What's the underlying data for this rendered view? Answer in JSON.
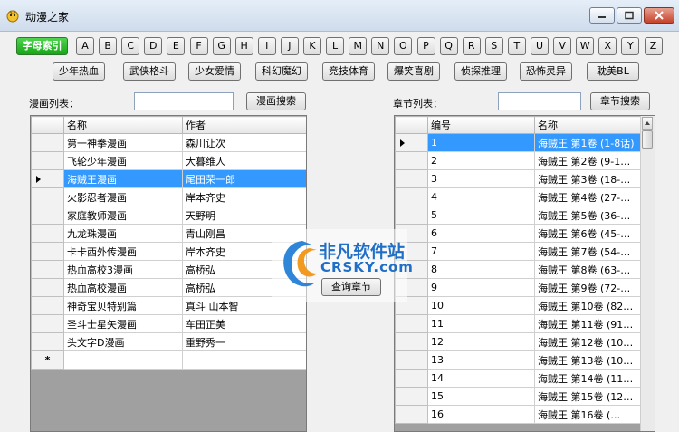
{
  "window": {
    "title": "动漫之家"
  },
  "letters": [
    "字母索引",
    "A",
    "B",
    "C",
    "D",
    "E",
    "F",
    "G",
    "H",
    "I",
    "J",
    "K",
    "L",
    "M",
    "N",
    "O",
    "P",
    "Q",
    "R",
    "S",
    "T",
    "U",
    "V",
    "W",
    "X",
    "Y",
    "Z"
  ],
  "categories": [
    "少年热血",
    "武侠格斗",
    "少女爱情",
    "科幻魔幻",
    "竞技体育",
    "爆笑喜剧",
    "侦探推理",
    "恐怖灵异",
    "耽美BL"
  ],
  "comic_search": {
    "label": "漫画列表：",
    "button": "漫画搜索",
    "value": ""
  },
  "chapter_search": {
    "label": "章节列表：",
    "button": "章节搜索",
    "value": ""
  },
  "query_button": "查询章节",
  "comic_table": {
    "columns": [
      "名称",
      "作者"
    ],
    "rows": [
      [
        "第一神拳漫画",
        "森川让次"
      ],
      [
        "飞轮少年漫画",
        "大暮维人"
      ],
      [
        "海贼王漫画",
        "尾田荣一郎"
      ],
      [
        "火影忍者漫画",
        "岸本齐史"
      ],
      [
        "家庭教师漫画",
        "天野明"
      ],
      [
        "九龙珠漫画",
        "青山刚昌"
      ],
      [
        "卡卡西外传漫画",
        "岸本齐史"
      ],
      [
        "热血高校3漫画",
        "高桥弘"
      ],
      [
        "热血高校漫画",
        "高桥弘"
      ],
      [
        "神奇宝贝特别篇",
        "真斗 山本智"
      ],
      [
        "圣斗士星矢漫画",
        "车田正美"
      ],
      [
        "头文字D漫画",
        "重野秀一"
      ]
    ],
    "new_row_marker": "*"
  },
  "chapter_table": {
    "columns": [
      "编号",
      "名称"
    ],
    "rows": [
      [
        "1",
        "海贼王 第1卷 (1-8话)"
      ],
      [
        "2",
        "海贼王 第2卷 (9-1…"
      ],
      [
        "3",
        "海贼王 第3卷 (18-…"
      ],
      [
        "4",
        "海贼王 第4卷 (27-…"
      ],
      [
        "5",
        "海贼王 第5卷 (36-…"
      ],
      [
        "6",
        "海贼王 第6卷 (45-…"
      ],
      [
        "7",
        "海贼王 第7卷 (54-…"
      ],
      [
        "8",
        "海贼王 第8卷 (63-…"
      ],
      [
        "9",
        "海贼王 第9卷 (72-…"
      ],
      [
        "10",
        "海贼王 第10卷 (82…"
      ],
      [
        "11",
        "海贼王 第11卷 (91…"
      ],
      [
        "12",
        "海贼王 第12卷 (10…"
      ],
      [
        "13",
        "海贼王 第13卷 (10…"
      ],
      [
        "14",
        "海贼王 第14卷 (11…"
      ],
      [
        "15",
        "海贼王 第15卷 (12…"
      ],
      [
        "16",
        "海贼王 第16卷 (…"
      ]
    ]
  },
  "watermark": {
    "cn": "非凡软件站",
    "en": "CRSKY.com"
  }
}
